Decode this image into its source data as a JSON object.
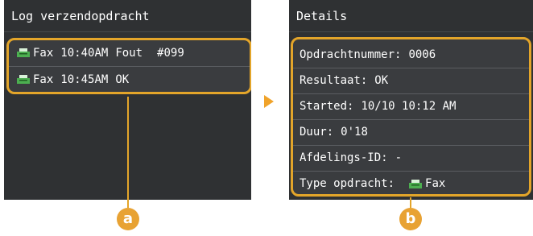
{
  "left_panel": {
    "title": "Log verzendopdracht",
    "jobs": [
      {
        "type": "Fax",
        "time": "10:40AM",
        "status": "Fout",
        "number": "#099"
      },
      {
        "type": "Fax",
        "time": "10:45AM",
        "status": "OK",
        "number": ""
      }
    ]
  },
  "right_panel": {
    "title": "Details",
    "rows": [
      {
        "label": "Opdrachtnummer:",
        "value": "0006"
      },
      {
        "label": "Resultaat:",
        "value": "OK"
      },
      {
        "label": "Started:",
        "value": "10/10 10:12 AM"
      },
      {
        "label": "Duur:",
        "value": "0'18"
      },
      {
        "label": "Afdelings-ID:",
        "value": "-"
      },
      {
        "label": "Type opdracht:",
        "value": "Fax",
        "icon": "fax-icon"
      }
    ]
  },
  "callouts": {
    "a": "a",
    "b": "b"
  },
  "colors": {
    "screen_bg": "#2f3133",
    "highlight": "#e3a52a",
    "callout": "#e8a233",
    "fax_icon": "#4caf50"
  }
}
